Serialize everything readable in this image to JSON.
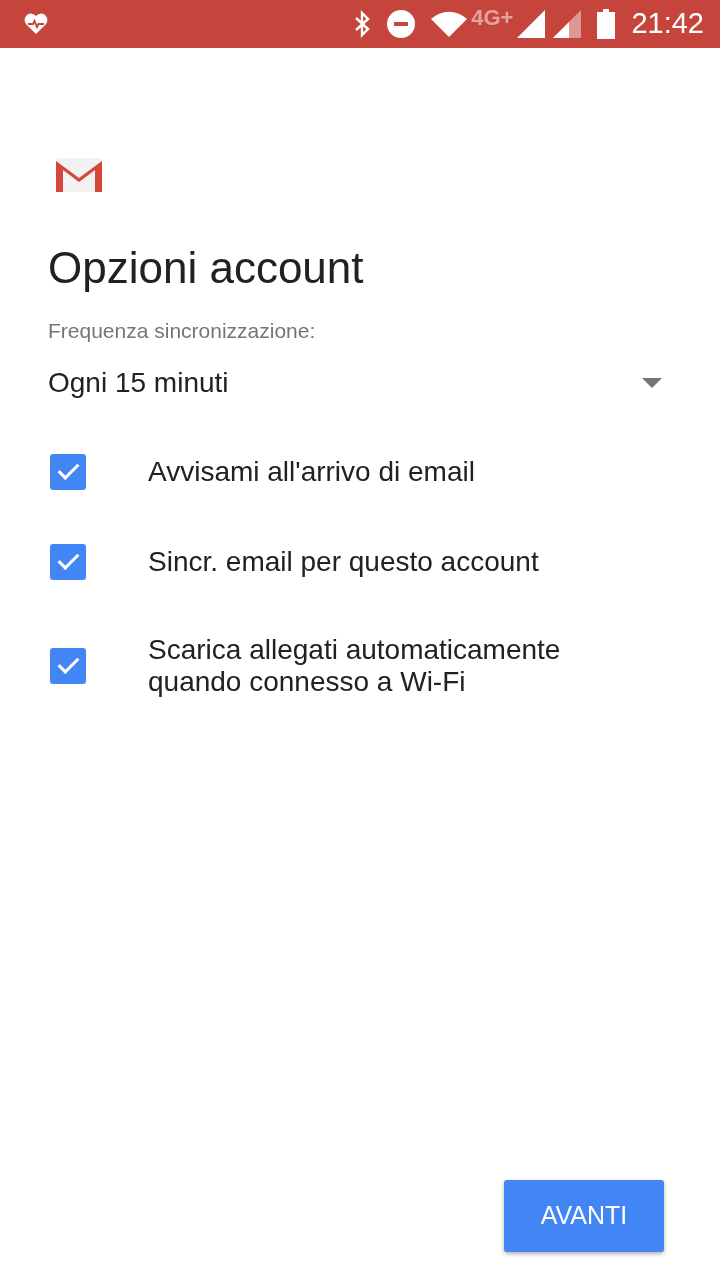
{
  "status_bar": {
    "network": "4G+",
    "time": "21:42"
  },
  "title": "Opzioni account",
  "sync": {
    "label": "Frequenza sincronizzazione:",
    "value": "Ogni 15 minuti"
  },
  "options": [
    {
      "label": "Avvisami all'arrivo di email",
      "checked": true
    },
    {
      "label": "Sincr. email per questo account",
      "checked": true
    },
    {
      "label": "Scarica allegati automaticamente quando connesso a Wi-Fi",
      "checked": true
    }
  ],
  "button": "AVANTI"
}
